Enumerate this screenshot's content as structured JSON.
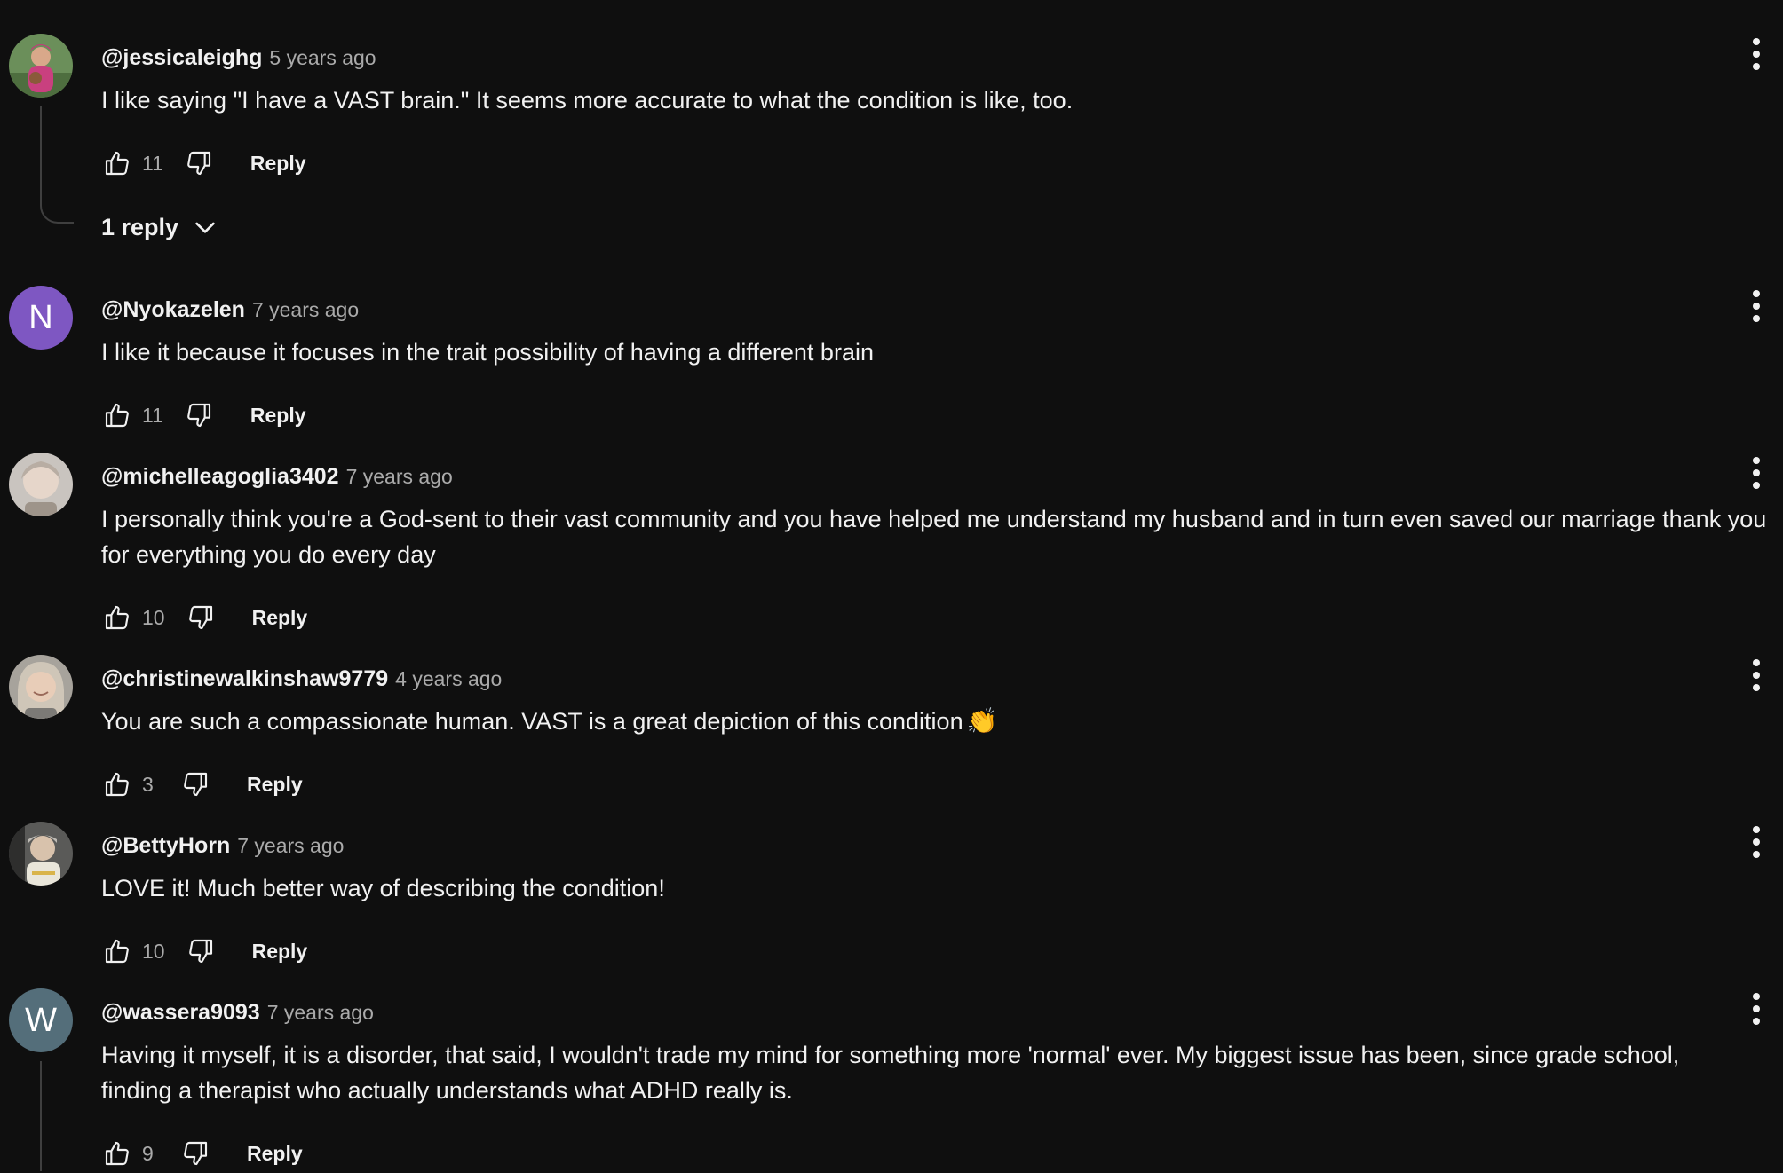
{
  "comments": [
    {
      "author": "@jessicaleighg",
      "time": "5 years ago",
      "text": "I like saying \"I have a VAST brain.\" It seems more accurate to what the condition is like, too.",
      "likes": "11",
      "reply_label": "Reply",
      "avatar": {
        "type": "photo",
        "icon": "avatar-photo-person-pink-shirt"
      }
    },
    {
      "author": "@Nyokazelen",
      "time": "7 years ago",
      "text": "I like it because it focuses in the trait possibility of having a different brain",
      "likes": "11",
      "reply_label": "Reply",
      "avatar": {
        "type": "letter",
        "letter": "N",
        "color": "#7e57c2"
      }
    },
    {
      "author": "@michelleagoglia3402",
      "time": "7 years ago",
      "text": "I personally think you're a God-sent to their vast community and you have helped me understand my husband and in turn even saved our marriage thank you for everything you do every day",
      "likes": "10",
      "reply_label": "Reply",
      "avatar": {
        "type": "photo",
        "icon": "avatar-photo-person-light"
      }
    },
    {
      "author": "@christinewalkinshaw9779",
      "time": "4 years ago",
      "text": "You are such a compassionate human.  VAST is a great depiction of this condition",
      "emoji": "👏",
      "likes": "3",
      "reply_label": "Reply",
      "avatar": {
        "type": "photo",
        "icon": "avatar-photo-person-smiling"
      }
    },
    {
      "author": "@BettyHorn",
      "time": "7 years ago",
      "text": "LOVE it! Much better way of describing the condition!",
      "likes": "10",
      "reply_label": "Reply",
      "avatar": {
        "type": "photo",
        "icon": "avatar-photo-person-cap"
      }
    },
    {
      "author": "@wassera9093",
      "time": "7 years ago",
      "text": "Having it myself, it is a disorder, that said, I wouldn't trade my mind for something more 'normal' ever. My biggest issue has been, since grade school, finding a therapist who actually understands what ADHD really is.",
      "likes": "9",
      "reply_label": "Reply",
      "avatar": {
        "type": "letter",
        "letter": "W",
        "color": "#546e7a"
      }
    }
  ],
  "replies_toggle": {
    "label": "1 reply",
    "icon": "chevron-down-icon"
  },
  "icons": {
    "like": "thumb-up-icon",
    "dislike": "thumb-down-icon",
    "menu": "more-vertical-icon"
  },
  "colors": {
    "background": "#0f0f0f",
    "text": "#f1f1f1",
    "secondary_text": "#aaaaaa",
    "thread_line": "#3f3f3f"
  }
}
